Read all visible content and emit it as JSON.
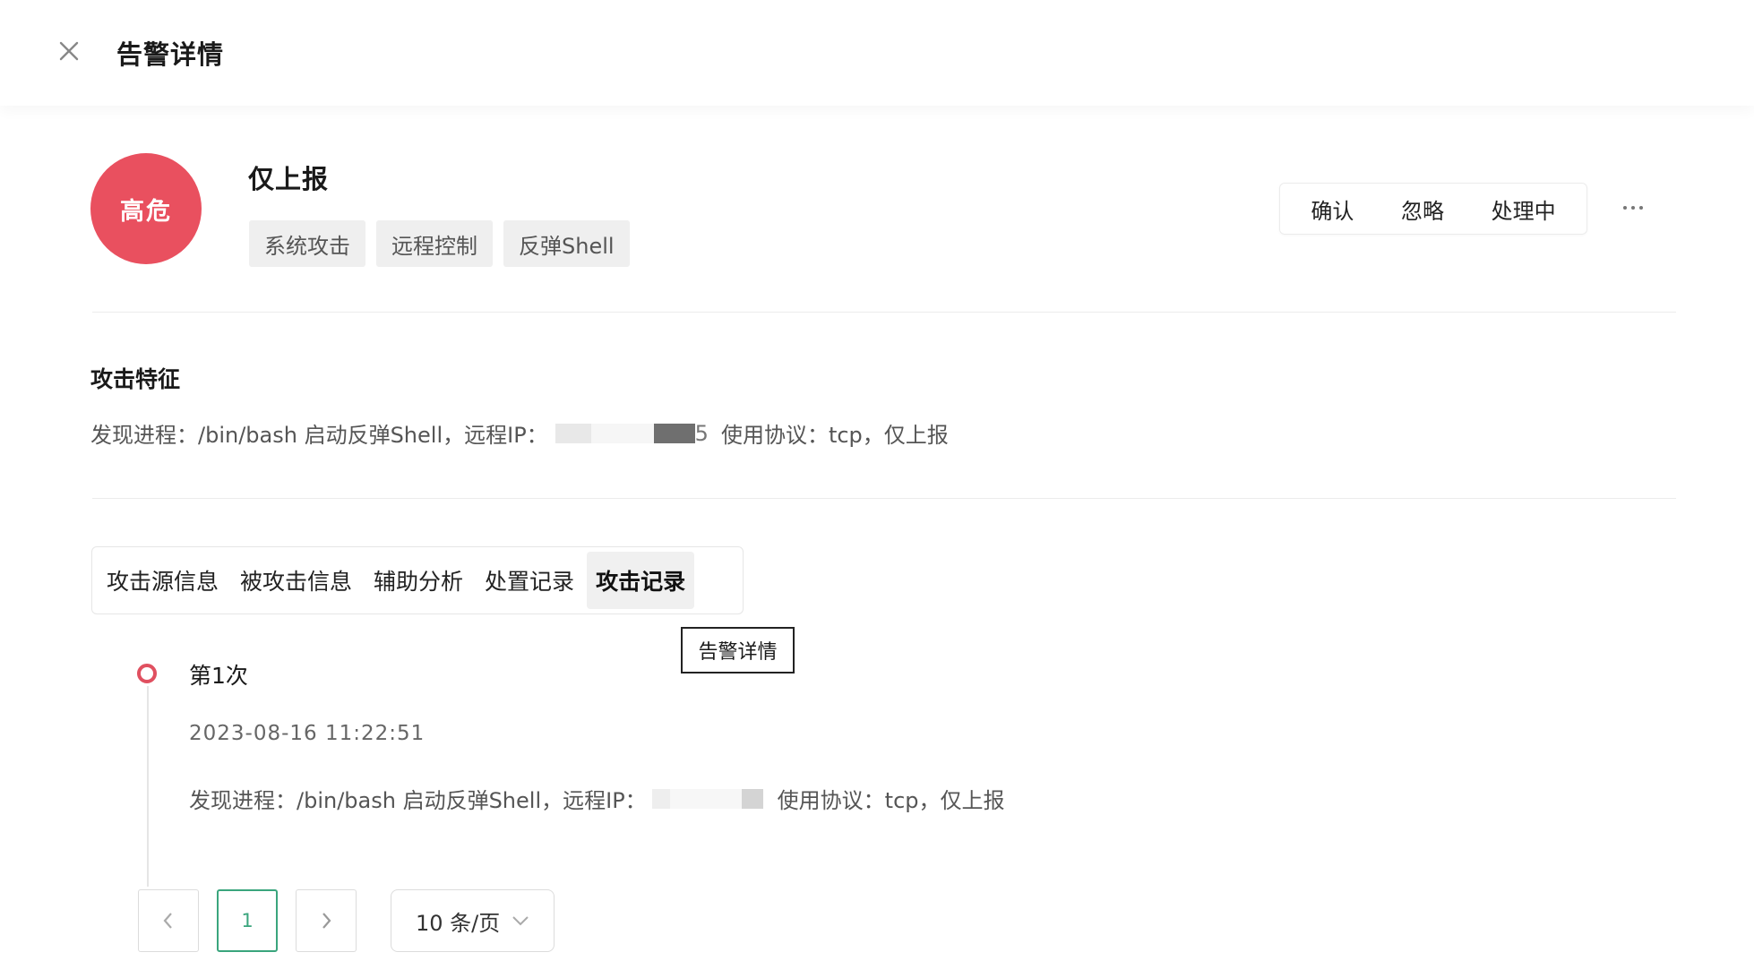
{
  "header": {
    "title": "告警详情"
  },
  "alert": {
    "severity": "高危",
    "severity_color": "#e9505f",
    "name": "仅上报",
    "tags": [
      "系统攻击",
      "远程控制",
      "反弹Shell"
    ]
  },
  "actions": {
    "confirm": "确认",
    "ignore": "忽略",
    "processing": "处理中",
    "more": "···"
  },
  "features": {
    "title": "攻击特征",
    "desc_prefix": "发现进程：/bin/bash 启动反弹Shell，远程IP：",
    "desc_suffix": "使用协议：tcp，仅上报"
  },
  "tabs": [
    {
      "label": "攻击源信息",
      "active": false
    },
    {
      "label": "被攻击信息",
      "active": false
    },
    {
      "label": "辅助分析",
      "active": false
    },
    {
      "label": "处置记录",
      "active": false
    },
    {
      "label": "攻击记录",
      "active": true
    }
  ],
  "tooltip": {
    "text": "告警详情"
  },
  "record": {
    "title": "第1次",
    "time": "2023-08-16 11:22:51",
    "desc_prefix": "发现进程：/bin/bash 启动反弹Shell，远程IP：",
    "desc_suffix": "使用协议：tcp，仅上报"
  },
  "pagination": {
    "current_page": "1",
    "page_size": "10 条/页"
  },
  "colors": {
    "accent": "#3aa57d",
    "timeline": "#e05060"
  }
}
